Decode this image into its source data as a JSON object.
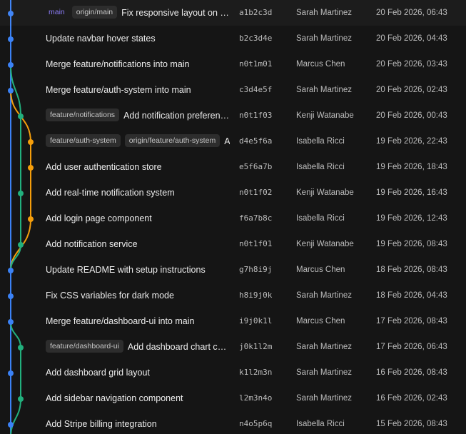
{
  "lane_colors": [
    "#3b82f6",
    "#f59e0b",
    "#22b07d"
  ],
  "commits": [
    {
      "refs": [
        {
          "label": "main",
          "kind": "head"
        },
        {
          "label": "origin/main",
          "kind": "remote"
        }
      ],
      "message": "Fix responsive layout on mobile",
      "hash": "a1b2c3d",
      "author": "Sarah Martinez",
      "date": "20 Feb 2026, 06:43",
      "lane": 0
    },
    {
      "refs": [],
      "message": "Update navbar hover states",
      "hash": "b2c3d4e",
      "author": "Sarah Martinez",
      "date": "20 Feb 2026, 04:43",
      "lane": 0
    },
    {
      "refs": [],
      "message": "Merge feature/notifications into main",
      "hash": "n0t1m01",
      "author": "Marcus Chen",
      "date": "20 Feb 2026, 03:43",
      "lane": 0
    },
    {
      "refs": [],
      "message": "Merge feature/auth-system into main",
      "hash": "c3d4e5f",
      "author": "Sarah Martinez",
      "date": "20 Feb 2026, 02:43",
      "lane": 0
    },
    {
      "refs": [
        {
          "label": "feature/notifications",
          "kind": "local"
        }
      ],
      "message": "Add notification preferences",
      "hash": "n0t1f03",
      "author": "Kenji Watanabe",
      "date": "20 Feb 2026, 00:43",
      "lane": 2
    },
    {
      "refs": [
        {
          "label": "feature/auth-system",
          "kind": "local"
        },
        {
          "label": "origin/feature/auth-system",
          "kind": "remote"
        }
      ],
      "message": "Add user authentication flow",
      "hash": "d4e5f6a",
      "author": "Isabella Ricci",
      "date": "19 Feb 2026, 22:43",
      "lane": 1
    },
    {
      "refs": [],
      "message": "Add user authentication store",
      "hash": "e5f6a7b",
      "author": "Isabella Ricci",
      "date": "19 Feb 2026, 18:43",
      "lane": 1
    },
    {
      "refs": [],
      "message": "Add real-time notification system",
      "hash": "n0t1f02",
      "author": "Kenji Watanabe",
      "date": "19 Feb 2026, 16:43",
      "lane": 2
    },
    {
      "refs": [],
      "message": "Add login page component",
      "hash": "f6a7b8c",
      "author": "Isabella Ricci",
      "date": "19 Feb 2026, 12:43",
      "lane": 1
    },
    {
      "refs": [],
      "message": "Add notification service",
      "hash": "n0t1f01",
      "author": "Kenji Watanabe",
      "date": "19 Feb 2026, 08:43",
      "lane": 2
    },
    {
      "refs": [],
      "message": "Update README with setup instructions",
      "hash": "g7h8i9j",
      "author": "Marcus Chen",
      "date": "18 Feb 2026, 08:43",
      "lane": 0
    },
    {
      "refs": [],
      "message": "Fix CSS variables for dark mode",
      "hash": "h8i9j0k",
      "author": "Sarah Martinez",
      "date": "18 Feb 2026, 04:43",
      "lane": 0
    },
    {
      "refs": [],
      "message": "Merge feature/dashboard-ui into main",
      "hash": "i9j0k1l",
      "author": "Marcus Chen",
      "date": "17 Feb 2026, 08:43",
      "lane": 0
    },
    {
      "refs": [
        {
          "label": "feature/dashboard-ui",
          "kind": "local"
        }
      ],
      "message": "Add dashboard chart components",
      "hash": "j0k1l2m",
      "author": "Sarah Martinez",
      "date": "17 Feb 2026, 06:43",
      "lane": 2
    },
    {
      "refs": [],
      "message": "Add dashboard grid layout",
      "hash": "k1l2m3n",
      "author": "Sarah Martinez",
      "date": "16 Feb 2026, 08:43",
      "lane": 0
    },
    {
      "refs": [],
      "message": "Add sidebar navigation component",
      "hash": "l2m3n4o",
      "author": "Sarah Martinez",
      "date": "16 Feb 2026, 02:43",
      "lane": 2
    },
    {
      "refs": [],
      "message": "Add Stripe billing integration",
      "hash": "n4o5p6q",
      "author": "Isabella Ricci",
      "date": "15 Feb 2026, 08:43",
      "lane": 0
    }
  ]
}
